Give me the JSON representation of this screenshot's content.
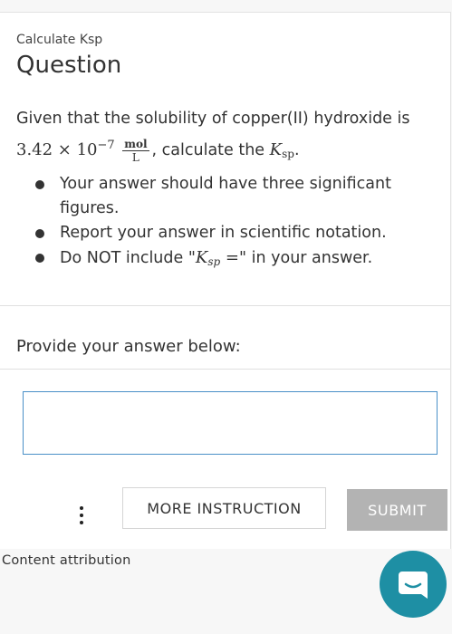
{
  "header": {
    "eyebrow": "Calculate Ksp",
    "title": "Question"
  },
  "question": {
    "intro": "Given that the solubility of copper(II) hydroxide is",
    "value": "3.42 × 10",
    "exponent": "−7",
    "unit_num": "mol",
    "unit_den": "L",
    "tail": ", calculate the ",
    "k_symbol": "K",
    "k_sub": "sp",
    "end": "."
  },
  "bullets": [
    {
      "text": "Your answer should have three significant figures."
    },
    {
      "text": "Report your answer in scientific notation."
    },
    {
      "prefix": "Do NOT include \"",
      "k_symbol": "K",
      "k_sub": "sp",
      "suffix_math": " =",
      "suffix": "\" in your answer."
    }
  ],
  "answer": {
    "prompt": "Provide your answer below:",
    "value": ""
  },
  "buttons": {
    "more_instruction": "MORE INSTRUCTION",
    "submit": "SUBMIT"
  },
  "footer": {
    "attribution": "Content attribution"
  },
  "colors": {
    "input_border": "#4a90c8",
    "submit_disabled": "#b3b3b3",
    "chat_button": "#1e8fa4"
  },
  "icons": {
    "menu": "more-vertical-icon",
    "chat": "chat-bubble-icon"
  }
}
